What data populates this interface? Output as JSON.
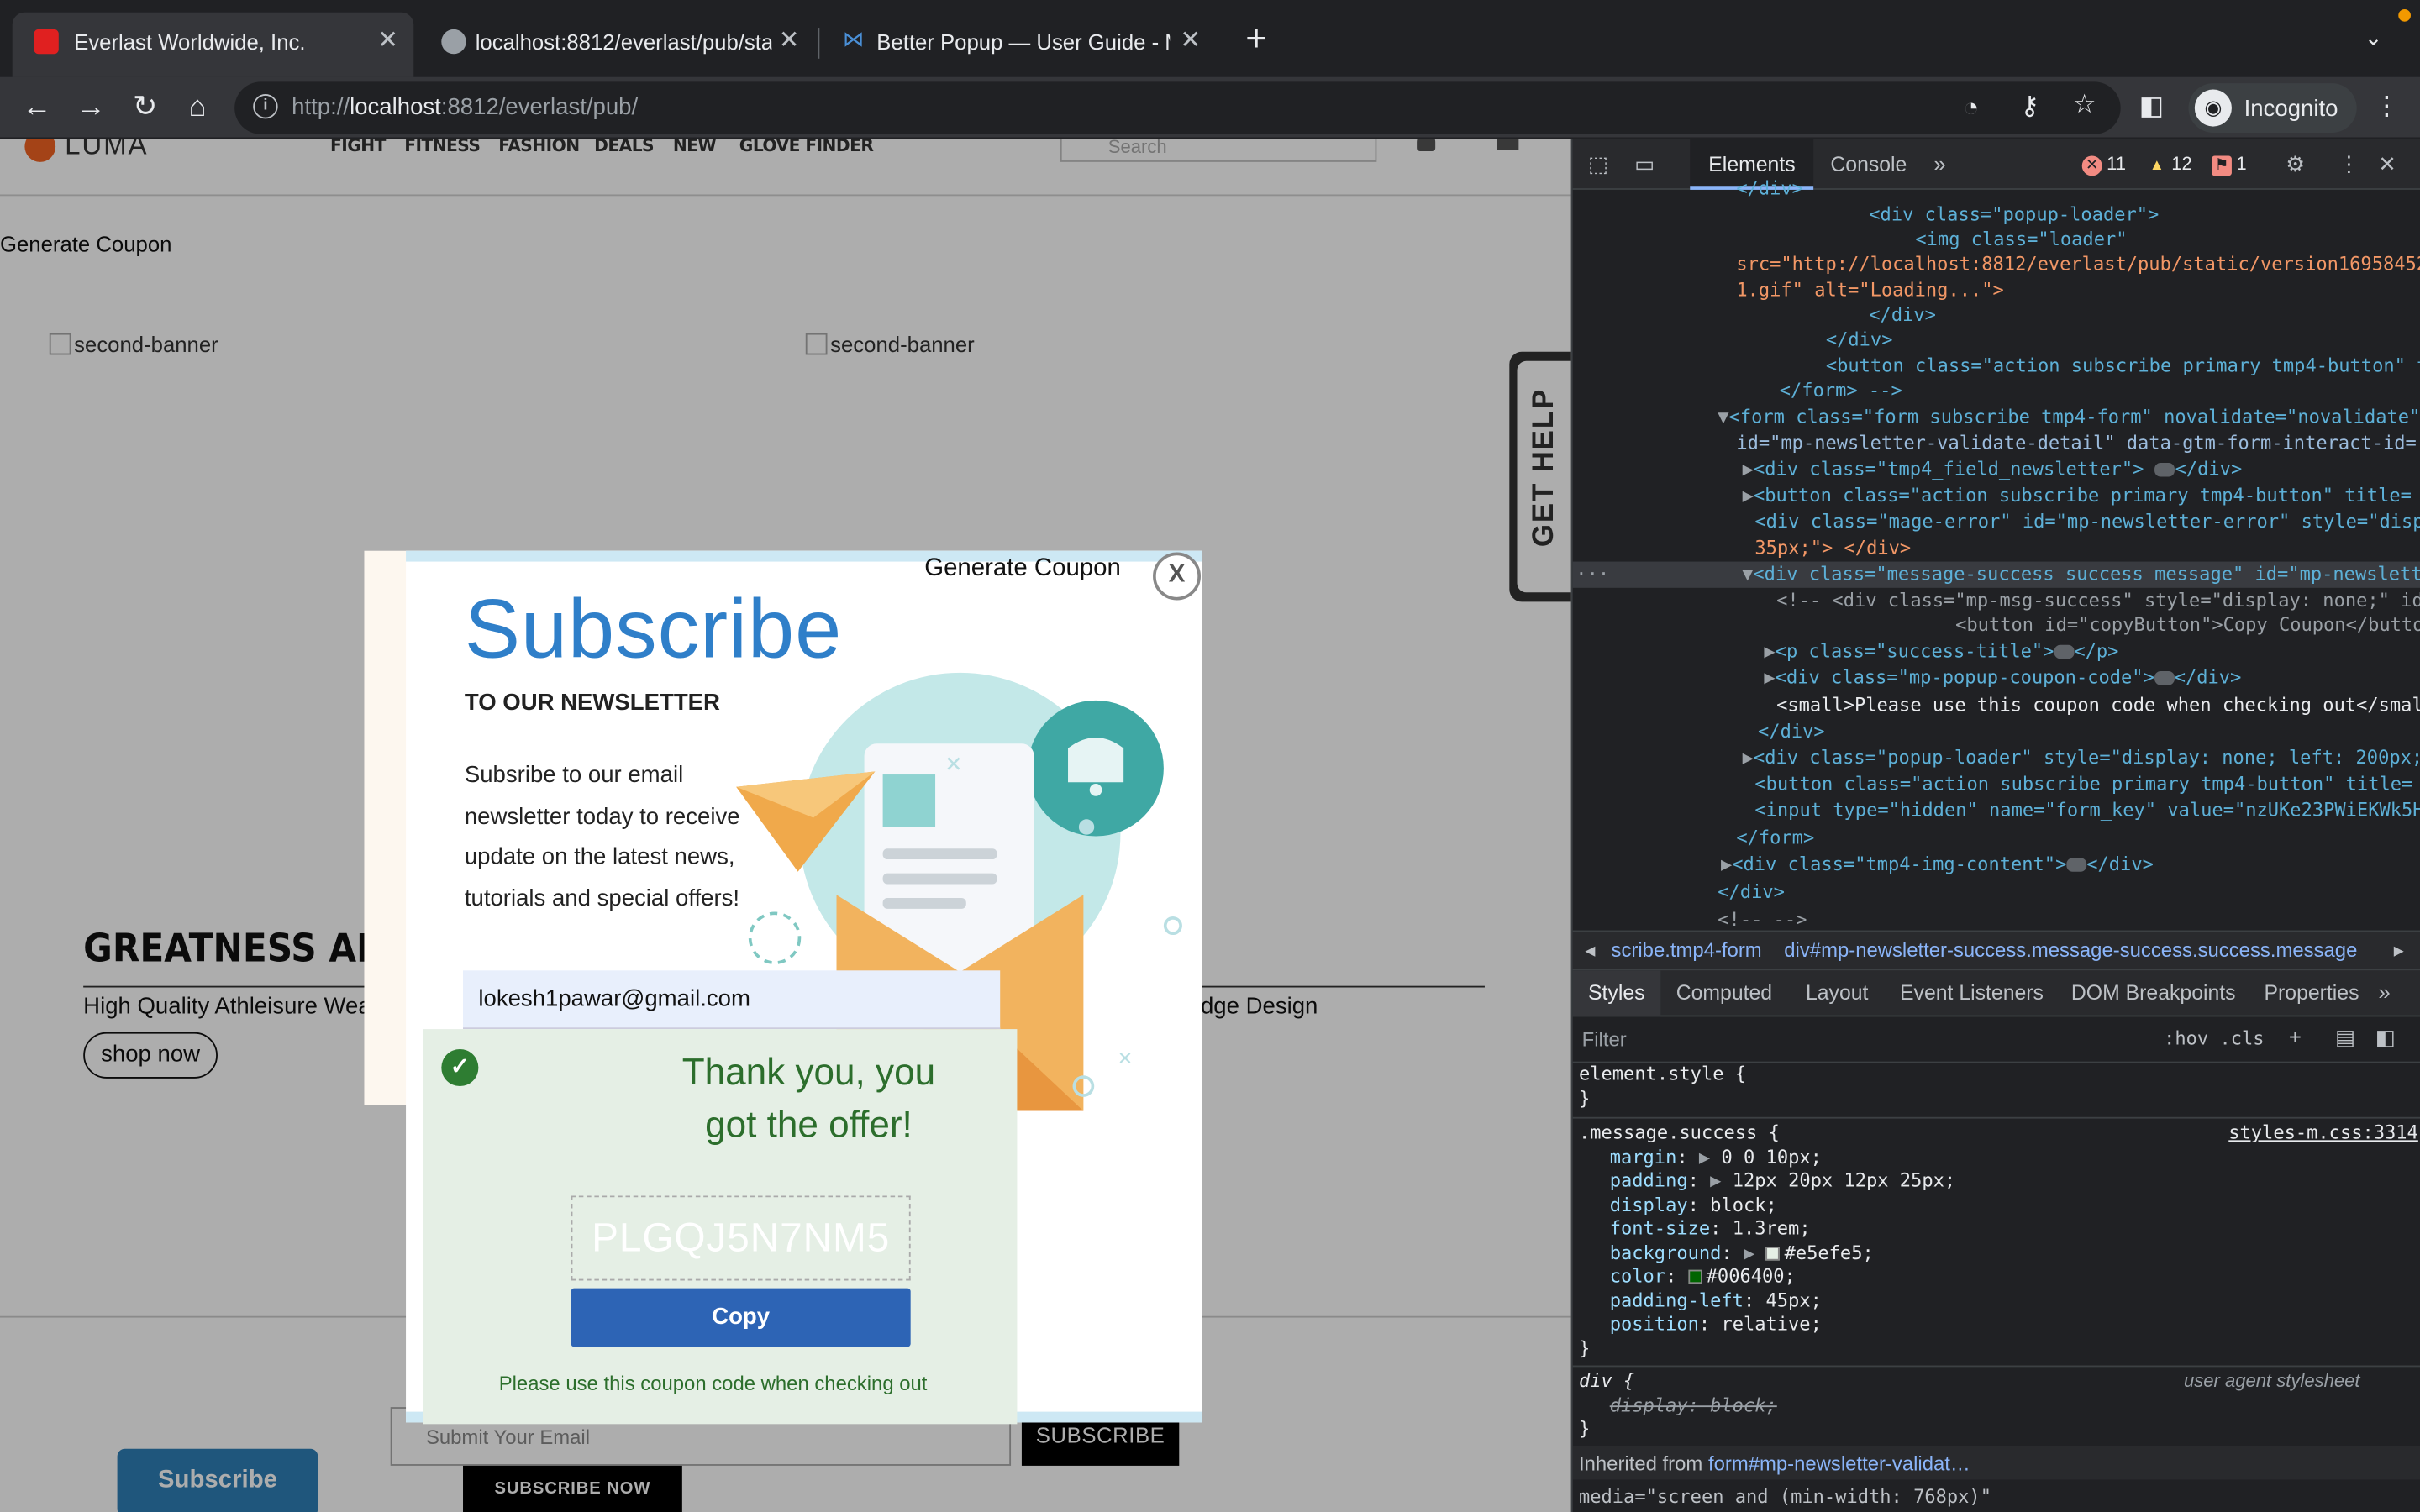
{
  "browser": {
    "tabs": [
      {
        "title": "Everlast Worldwide, Inc.",
        "active": true,
        "favicon_color": "#e02020"
      },
      {
        "title": "localhost:8812/everlast/pub/sta",
        "active": false,
        "favicon_color": "#9aa0a6"
      },
      {
        "title": "Better Popup — User Guide - M",
        "active": false,
        "favicon_color": "#4a8fd6"
      }
    ],
    "url_prefix": "http://",
    "url_host": "localhost",
    "url_rest": ":8812/everlast/pub/",
    "profile_label": "Incognito"
  },
  "page": {
    "logo_text": "LUMA",
    "nav_items": [
      "FIGHT",
      "FITNESS",
      "FASHION",
      "DEALS",
      "NEW",
      "GLOVE FINDER"
    ],
    "search_placeholder": "Search",
    "generate_coupon": "Generate Coupon",
    "banner_alt_1": "second-banner",
    "banner_alt_2": "second-banner",
    "greatness_heading": "GREATNESS API",
    "hq_text": "High Quality Athleisure Wea",
    "edge_text": "dge Design",
    "shop_now": "shop now",
    "get_help": "GET HELP",
    "footer_email_placeholder": "Submit Your Email",
    "footer_subscribe": "SUBSCRIBE",
    "subscribe_now": "SUBSCRIBE NOW",
    "subscribe_button": "Subscribe"
  },
  "popup": {
    "header_link": "Generate Coupon",
    "close": "X",
    "title": "Subscribe",
    "subtitle": "TO OUR NEWSLETTER",
    "description": "Subsribe to our email newsletter today to receive update on the latest news, tutorials and special offers!",
    "email_value": "lokesh1pawar@gmail.com",
    "success_title": "Thank you, you got the offer!",
    "coupon_code": "PLGQJ5N7NM5",
    "copy_button": "Copy",
    "note": "Please use this coupon code when checking out"
  },
  "devtools": {
    "tabs": [
      "Elements",
      "Console"
    ],
    "errors": "11",
    "warnings": "12",
    "issues": "1",
    "lines": [
      {
        "t": "</div>"
      },
      {
        "t": "<div class=\"popup-loader\">"
      },
      {
        "t": "<img class=\"loader\""
      },
      {
        "t": "src=\"http://localhost:8812/everlast/pub/static/version16958452"
      },
      {
        "t": "1.gif\" alt=\"Loading...\">"
      },
      {
        "t": "</div>"
      },
      {
        "t": "</div>"
      },
      {
        "t": "<button class=\"action subscribe primary tmp4-button\" t"
      },
      {
        "t": "</form> -->"
      },
      {
        "t": "<form class=\"form subscribe tmp4-form\" novalidate=\"novalidate\""
      },
      {
        "t": "id=\"mp-newsletter-validate-detail\" data-gtm-form-interact-id="
      },
      {
        "t": "<div class=\"tmp4_field_newsletter\">"
      },
      {
        "t": "<button class=\"action subscribe primary tmp4-button\" title="
      },
      {
        "t": "<div class=\"mage-error\" id=\"mp-newsletter-error\" style=\"disp"
      },
      {
        "t": "35px;\"> </div>"
      },
      {
        "t": "<div class=\"message-success success message\" id=\"mp-newslett"
      },
      {
        "t": "<!-- <div class=\"mp-msg-success\" style=\"display: none;\" id"
      },
      {
        "t": "<button id=\"copyButton\">Copy Coupon</butto"
      },
      {
        "t": "<p class=\"success-title\">"
      },
      {
        "t": "<div class=\"mp-popup-coupon-code\">"
      },
      {
        "t": "<small>Please use this coupon code when checking out</smal"
      },
      {
        "t": "</div>"
      },
      {
        "t": "<div class=\"popup-loader\" style=\"display: none; left: 200px;"
      },
      {
        "t": "<button class=\"action subscribe primary tmp4-button\" title="
      },
      {
        "t": "<input type=\"hidden\" name=\"form_key\" value=\"nzUKe23PWiEKWk5H"
      },
      {
        "t": "</form>"
      },
      {
        "t": "<div class=\"tmp4-img-content\">"
      },
      {
        "t": "</div>"
      },
      {
        "t": "<!-- -->"
      }
    ],
    "breadcrumb_1": "scribe.tmp4-form",
    "breadcrumb_2": "div#mp-newsletter-success.message-success.success.message",
    "subtabs": [
      "Styles",
      "Computed",
      "Layout",
      "Event Listeners",
      "DOM Breakpoints",
      "Properties"
    ],
    "filter_placeholder": "Filter",
    "hov_cls": ":hov  .cls",
    "element_style": "element.style {",
    "rule_selector": ".message.success {",
    "rule_source": "styles-m.css:3314",
    "props": [
      {
        "name": "margin",
        "value": "0 0 10px;"
      },
      {
        "name": "padding",
        "value": "12px 20px 12px 25px;"
      },
      {
        "name": "display",
        "value": "block;"
      },
      {
        "name": "font-size",
        "value": "1.3rem;"
      },
      {
        "name": "background",
        "value": "#e5efe5;"
      },
      {
        "name": "color",
        "value": "#006400;"
      },
      {
        "name": "padding-left",
        "value": "45px;"
      },
      {
        "name": "position",
        "value": "relative;"
      }
    ],
    "ua_selector": "div {",
    "ua_label": "user agent stylesheet",
    "ua_prop": "display: block;",
    "inherited": "Inherited from ",
    "inherited_from": "form#mp-newsletter-validat…",
    "media": "media=\"screen and (min-width: 768px)\""
  }
}
